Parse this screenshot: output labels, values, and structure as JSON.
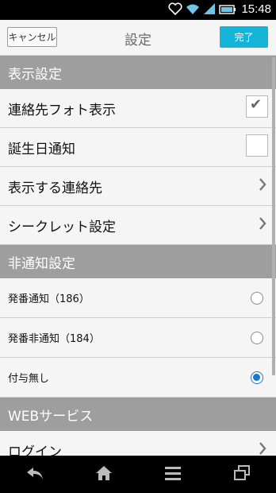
{
  "status_bar": {
    "time": "15:48"
  },
  "header": {
    "cancel_label": "キャンセル",
    "title": "設定",
    "done_label": "完了"
  },
  "sections": [
    {
      "title": "表示設定"
    },
    {
      "title": "非通知設定"
    },
    {
      "title": "WEBサービス"
    }
  ],
  "display_settings": {
    "photo_label": "連絡先フォト表示",
    "photo_checked": true,
    "birthday_label": "誕生日通知",
    "birthday_checked": false,
    "contacts_label": "表示する連絡先",
    "secret_label": "シークレット設定"
  },
  "privacy_settings": {
    "options": [
      {
        "label": "発番通知（186）",
        "selected": false
      },
      {
        "label": "発番非通知（184）",
        "selected": false
      },
      {
        "label": "付与無し",
        "selected": true
      }
    ]
  },
  "web_services": {
    "login_label": "ログイン"
  },
  "colors": {
    "accent": "#14b3d8",
    "section_bg": "#9e9e9e",
    "radio_on": "#1a78c8"
  },
  "icons": [
    "heart-icon",
    "wifi-icon",
    "signal-icon",
    "battery-icon",
    "back-icon",
    "home-icon",
    "menu-icon",
    "recent-apps-icon",
    "chevron-right-icon",
    "checkmark-icon"
  ]
}
